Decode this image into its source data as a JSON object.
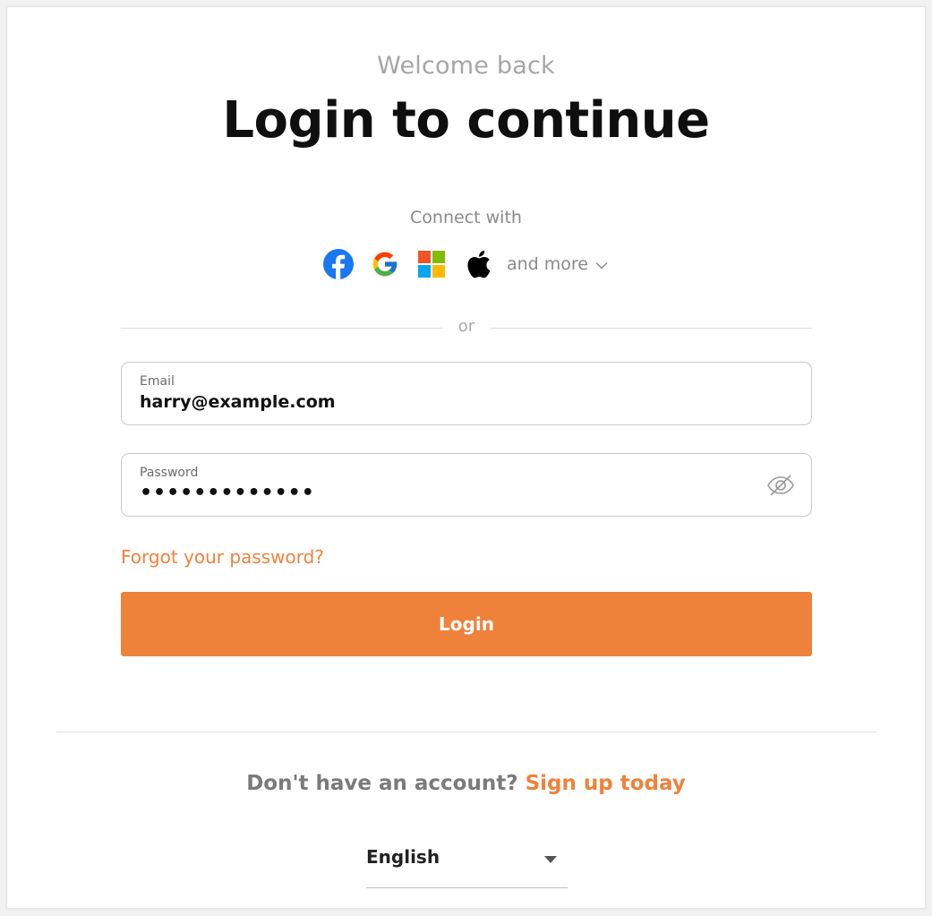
{
  "header": {
    "subtitle": "Welcome back",
    "title": "Login to continue"
  },
  "social": {
    "label": "Connect with",
    "providers": [
      {
        "name": "Facebook",
        "icon": "facebook-icon"
      },
      {
        "name": "Google",
        "icon": "google-icon"
      },
      {
        "name": "Microsoft",
        "icon": "microsoft-icon"
      },
      {
        "name": "Apple",
        "icon": "apple-icon"
      }
    ],
    "more_label": "and more"
  },
  "divider": {
    "text": "or"
  },
  "form": {
    "email": {
      "label": "Email",
      "value": "harry@example.com"
    },
    "password": {
      "label": "Password",
      "value": "•••••••••••••"
    },
    "forgot_label": "Forgot your password?",
    "login_label": "Login"
  },
  "signup": {
    "prompt": "Don't have an account?",
    "link_label": "Sign up today"
  },
  "language": {
    "selected": "English"
  },
  "colors": {
    "accent": "#ef823b",
    "facebook": "#1877f2",
    "text_dark": "#0f0f0f",
    "text_muted": "#8a8a8a"
  }
}
